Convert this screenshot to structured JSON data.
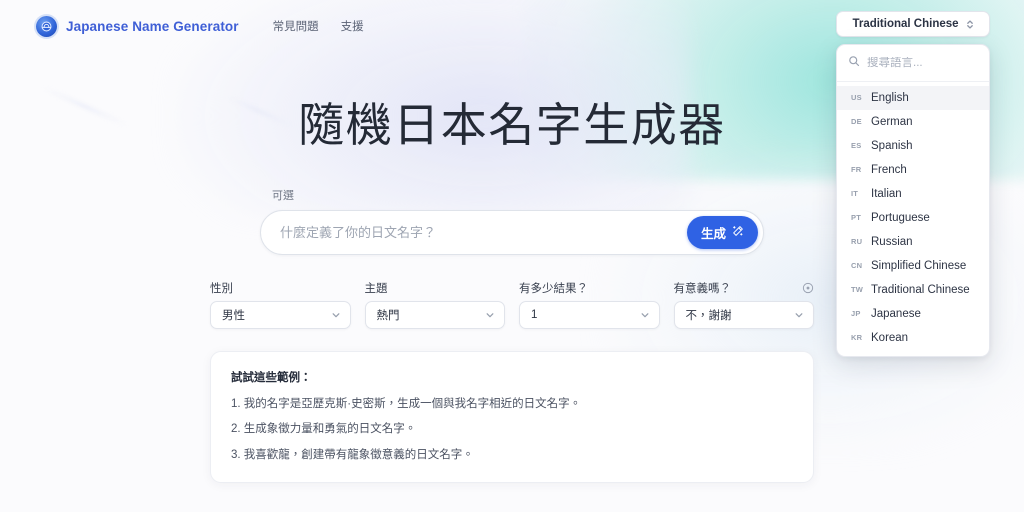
{
  "header": {
    "brand_name": "Japanese Name Generator",
    "logo_icon": "globe-badge-icon",
    "nav": [
      {
        "label": "常見問題"
      },
      {
        "label": "支援"
      }
    ]
  },
  "language_selector": {
    "selected": "Traditional Chinese",
    "chevron_icon": "chevron-up-down-icon",
    "search_icon": "search-icon",
    "search_placeholder": "搜尋語言...",
    "search_value": "",
    "options": [
      {
        "code": "us",
        "label": "English",
        "active": true
      },
      {
        "code": "de",
        "label": "German",
        "active": false
      },
      {
        "code": "es",
        "label": "Spanish",
        "active": false
      },
      {
        "code": "fr",
        "label": "French",
        "active": false
      },
      {
        "code": "it",
        "label": "Italian",
        "active": false
      },
      {
        "code": "pt",
        "label": "Portuguese",
        "active": false
      },
      {
        "code": "ru",
        "label": "Russian",
        "active": false
      },
      {
        "code": "cn",
        "label": "Simplified Chinese",
        "active": false
      },
      {
        "code": "tw",
        "label": "Traditional Chinese",
        "active": false
      },
      {
        "code": "jp",
        "label": "Japanese",
        "active": false
      },
      {
        "code": "kr",
        "label": "Korean",
        "active": false
      }
    ]
  },
  "main": {
    "title": "隨機日本名字生成器",
    "prompt": {
      "label": "可選",
      "placeholder": "什麼定義了你的日文名字？",
      "value": "",
      "generate_label": "生成",
      "generate_icon": "magic-wand-icon"
    },
    "options": [
      {
        "label": "性別",
        "value": "男性",
        "info": false
      },
      {
        "label": "主題",
        "value": "熱門",
        "info": false
      },
      {
        "label": "有多少結果？",
        "value": "1",
        "info": false
      },
      {
        "label": "有意義嗎？",
        "value": "不，謝謝",
        "info": true
      }
    ],
    "examples": {
      "title": "試試這些範例：",
      "items": [
        "1. 我的名字是亞歷克斯·史密斯，生成一個與我名字相近的日文名字。",
        "2. 生成象徵力量和勇氣的日文名字。",
        "3. 我喜歡龍，創建帶有龍象徵意義的日文名字。"
      ]
    }
  },
  "colors": {
    "brand_blue": "#3f5fd6",
    "accent_button": "#2f62e4",
    "page_background": "#fbfbfd",
    "teal_blob": "#8ee2d8",
    "lavender_blob": "#dee1f5"
  }
}
